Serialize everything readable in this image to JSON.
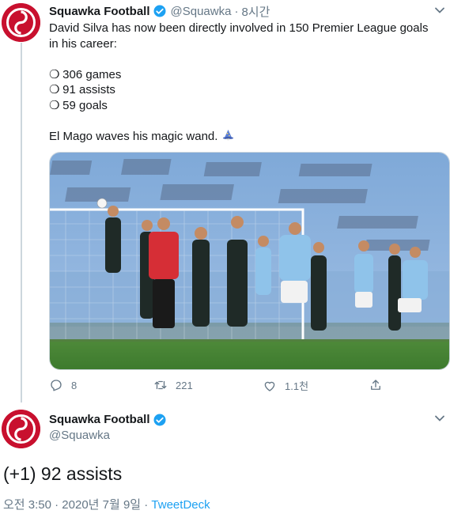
{
  "tweet1": {
    "author_name": "Squawka Football",
    "author_handle": "@Squawka",
    "time": "8시간",
    "lines": {
      "intro": "David Silva has now been directly involved in 150 Premier League goals in his career:",
      "games": "306 games",
      "assists": "91 assists",
      "goals": "59 goals",
      "closing": "El Mago waves his magic wand."
    },
    "bullet_glyph": "❍",
    "emoji": "wizard-emoji",
    "media_description": "football-free-kick-photo",
    "actions": {
      "replies": "8",
      "retweets": "221",
      "likes": "1.1천"
    }
  },
  "tweet2": {
    "author_name": "Squawka Football",
    "author_handle": "@Squawka",
    "text": "(+1) 92 assists",
    "timestamp": "오전 3:50 · 2020년 7월 9일 · ",
    "source": "TweetDeck"
  },
  "colors": {
    "brand_red": "#c8102e",
    "verified_blue": "#1da1f2",
    "muted": "#657786",
    "link": "#1da1f2"
  },
  "icons": [
    "chevron-down-icon",
    "verified-badge-icon",
    "reply-icon",
    "retweet-icon",
    "like-icon",
    "share-icon"
  ]
}
